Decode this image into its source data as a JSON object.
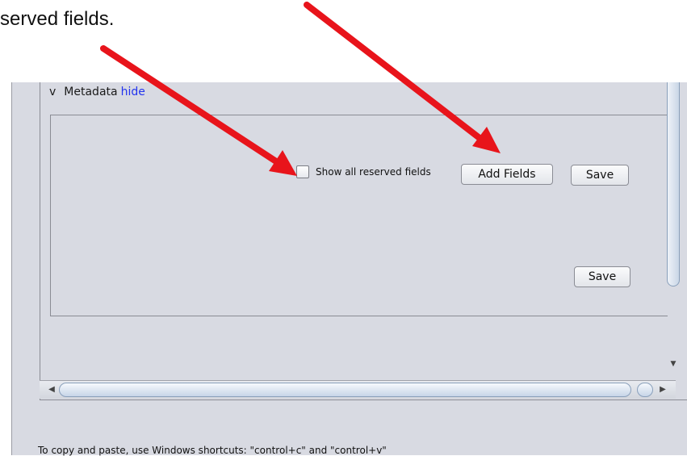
{
  "caption": "served fields.",
  "metadata": {
    "toggle": "v",
    "title": "Metadata",
    "hide_link": "hide"
  },
  "checkbox": {
    "label": "Show all reserved fields",
    "checked": false
  },
  "buttons": {
    "add_fields": "Add Fields",
    "save_top": "Save",
    "save_bottom": "Save"
  },
  "footer": "To copy and paste, use Windows shortcuts: \"control+c\" and \"control+v\"",
  "colors": {
    "arrow": "#e8141b",
    "link": "#2233ee",
    "panel_bg": "#d8dae2"
  }
}
